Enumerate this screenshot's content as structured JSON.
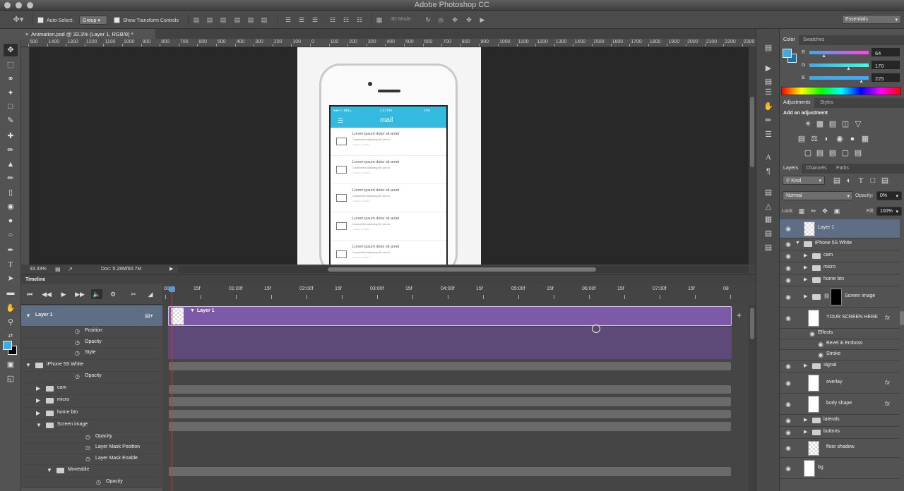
{
  "app": {
    "title": "Adobe Photoshop CC"
  },
  "options_bar": {
    "auto_select_label": "Auto-Select:",
    "auto_select_value": "Group",
    "show_transform_label": "Show Transform Controls",
    "mode_3d_label": "3D Mode:",
    "workspace": "Essentials"
  },
  "document": {
    "tab_title": "Animation.psd @ 33.3% (Layer 1, RGB/8) *",
    "zoom": "33.33%",
    "doc_size": "Doc: 5.28M/60.7M",
    "ruler_labels": [
      "500",
      "1400",
      "1300",
      "1200",
      "1100",
      "1000",
      "900",
      "800",
      "700",
      "600",
      "500",
      "400",
      "300",
      "200",
      "100",
      "0",
      "100",
      "200",
      "300",
      "400",
      "500",
      "600",
      "700",
      "800",
      "900",
      "1000",
      "1100",
      "1200",
      "1300",
      "1400",
      "1500",
      "1600",
      "1700",
      "1800",
      "1900",
      "2000",
      "2100",
      "2200",
      "2300",
      "2400"
    ]
  },
  "phone_screen": {
    "carrier": "●●●○○ BELL",
    "time": "4:21 PM",
    "battery": "22%",
    "app_title": "mail",
    "messages": [
      {
        "title": "Lorem ipsum dolor sit amet",
        "sub": "Consectetur adipiscing elit, sed do",
        "meta": "Tuesday, 10:30am"
      },
      {
        "title": "Lorem ipsum dolor sit amet",
        "sub": "Consectetur adipiscing elit, sed do",
        "meta": "Tuesday, 10:30am"
      },
      {
        "title": "Lorem ipsum dolor sit amet",
        "sub": "Consectetur adipiscing elit, sed do",
        "meta": "Tuesday, 10:30am"
      },
      {
        "title": "Lorem ipsum dolor sit amet",
        "sub": "Consectetur adipiscing elit, sed do",
        "meta": "Tuesday, 10:30am"
      },
      {
        "title": "Lorem ipsum dolor sit amet",
        "sub": "Consectetur adipiscing elit, sed do",
        "meta": "Tuesday, 10:30am"
      }
    ]
  },
  "color_panel": {
    "tabs": [
      "Color",
      "Swatches"
    ],
    "channels": [
      {
        "label": "R",
        "value": "64",
        "gradient": "#ff45e1"
      },
      {
        "label": "G",
        "value": "170",
        "gradient": "#40ffe1"
      },
      {
        "label": "B",
        "value": "225",
        "gradient": "#40aaff"
      }
    ],
    "foreground": "#40aae1"
  },
  "adjustments_panel": {
    "tabs": [
      "Adjustments",
      "Styles"
    ],
    "heading": "Add an adjustment"
  },
  "layers_panel": {
    "tabs": [
      "Layers",
      "Channels",
      "Paths"
    ],
    "filter": "Kind",
    "blend_mode": "Normal",
    "opacity_label": "Opacity:",
    "opacity": "0%",
    "lock_label": "Lock:",
    "fill_label": "Fill:",
    "fill": "100%",
    "layers": [
      {
        "name": "Layer 1",
        "selected": true,
        "kind": "thumb",
        "indent": 0,
        "expander": ""
      },
      {
        "name": "iPhone 5S White",
        "kind": "folder",
        "indent": 0,
        "expander": "▼"
      },
      {
        "name": "cam",
        "kind": "folder",
        "indent": 1,
        "expander": "▶"
      },
      {
        "name": "micro",
        "kind": "folder",
        "indent": 1,
        "expander": "▶"
      },
      {
        "name": "home btn",
        "kind": "folder",
        "indent": 1,
        "expander": "▶"
      },
      {
        "name": "Screen image",
        "kind": "folder-mask",
        "indent": 1,
        "expander": "▶"
      },
      {
        "name": "YOUR SCREEN HERE",
        "kind": "smart",
        "indent": 1,
        "expander": "",
        "fx": "fx"
      },
      {
        "name": "Effects",
        "kind": "effect",
        "indent": 2,
        "expander": ""
      },
      {
        "name": "Bevel & Emboss",
        "kind": "effect",
        "indent": 3,
        "expander": ""
      },
      {
        "name": "Stroke",
        "kind": "effect",
        "indent": 3,
        "expander": ""
      },
      {
        "name": "signal",
        "kind": "folder",
        "indent": 1,
        "expander": "▶"
      },
      {
        "name": "overlay",
        "kind": "smart",
        "indent": 1,
        "expander": "",
        "fx": "fx"
      },
      {
        "name": "body shape",
        "kind": "smart",
        "indent": 1,
        "expander": "",
        "fx": "fx"
      },
      {
        "name": "laterals",
        "kind": "folder",
        "indent": 1,
        "expander": "▶"
      },
      {
        "name": "buttons",
        "kind": "folder",
        "indent": 1,
        "expander": "▶"
      },
      {
        "name": "floor shadow",
        "kind": "thumb",
        "indent": 1,
        "expander": ""
      },
      {
        "name": "bg",
        "kind": "smart",
        "indent": 0,
        "expander": ""
      }
    ]
  },
  "timeline": {
    "title": "Timeline",
    "ruler": [
      "00",
      "15f",
      "01:00f",
      "15f",
      "02:00f",
      "15f",
      "03:00f",
      "15f",
      "04:00f",
      "15f",
      "05:00f",
      "15f",
      "06:00f",
      "15f",
      "07:00f",
      "15f",
      "08"
    ],
    "clip_label": "Layer 1",
    "rows": [
      {
        "label": "Layer 1",
        "type": "layer",
        "indent": 0,
        "expander": "▼"
      },
      {
        "label": "Position",
        "type": "prop",
        "indent": 2,
        "expander": ""
      },
      {
        "label": "Opacity",
        "type": "prop",
        "indent": 2,
        "expander": ""
      },
      {
        "label": "Style",
        "type": "prop",
        "indent": 2,
        "expander": ""
      },
      {
        "label": "iPhone 5S White",
        "type": "group",
        "indent": 0,
        "expander": "▼"
      },
      {
        "label": "Opacity",
        "type": "prop",
        "indent": 2,
        "expander": ""
      },
      {
        "label": "cam",
        "type": "group",
        "indent": 1,
        "expander": "▶"
      },
      {
        "label": "micro",
        "type": "group",
        "indent": 1,
        "expander": "▶"
      },
      {
        "label": "home btn",
        "type": "group",
        "indent": 1,
        "expander": "▶"
      },
      {
        "label": "Screen image",
        "type": "group",
        "indent": 1,
        "expander": "▼"
      },
      {
        "label": "Opacity",
        "type": "prop",
        "indent": 3,
        "expander": ""
      },
      {
        "label": "Layer Mask Position",
        "type": "prop",
        "indent": 3,
        "expander": ""
      },
      {
        "label": "Layer Mask Enable",
        "type": "prop",
        "indent": 3,
        "expander": ""
      },
      {
        "label": "Moveable",
        "type": "group",
        "indent": 2,
        "expander": "▼"
      },
      {
        "label": "Opacity",
        "type": "prop",
        "indent": 4,
        "expander": ""
      }
    ]
  }
}
